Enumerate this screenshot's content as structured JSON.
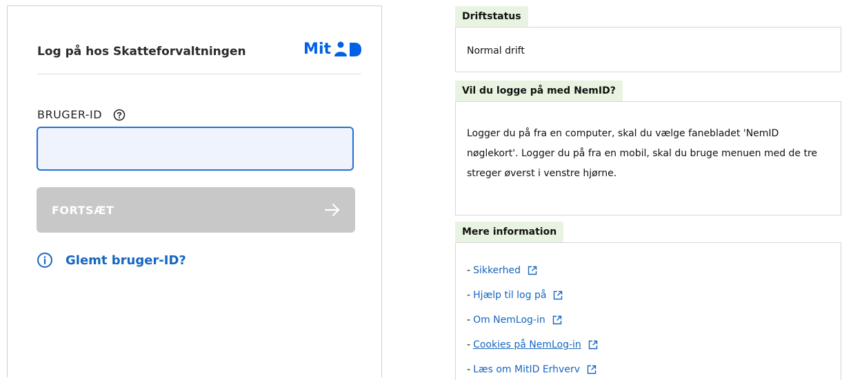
{
  "login": {
    "title": "Log på hos Skatteforvaltningen",
    "logo_text": "Mit",
    "field_label": "BRUGER-ID",
    "input_value": "",
    "continue_label": "FORTSÆT",
    "forgot_label": "Glemt bruger-ID?"
  },
  "status": {
    "tab": "Driftstatus",
    "text": "Normal drift"
  },
  "nemid": {
    "tab": "Vil du logge på med NemID?",
    "text": "Logger du på fra en computer, skal du vælge fanebladet 'NemID nøglekort'. Logger du på fra en mobil, skal du bruge menuen med de tre streger øverst i venstre hjørne."
  },
  "info": {
    "tab": "Mere information",
    "prefix": "-",
    "links": [
      {
        "label": "Sikkerhed"
      },
      {
        "label": "Hjælp til log på"
      },
      {
        "label": "Om NemLog-in"
      },
      {
        "label": "Cookies på NemLog-in"
      },
      {
        "label": "Læs om MitID Erhverv"
      }
    ]
  },
  "colors": {
    "mitid_blue": "#0060e6",
    "link_blue": "#1565c0",
    "tab_green": "#e8f4e1",
    "button_disabled": "#c8c8c8"
  }
}
